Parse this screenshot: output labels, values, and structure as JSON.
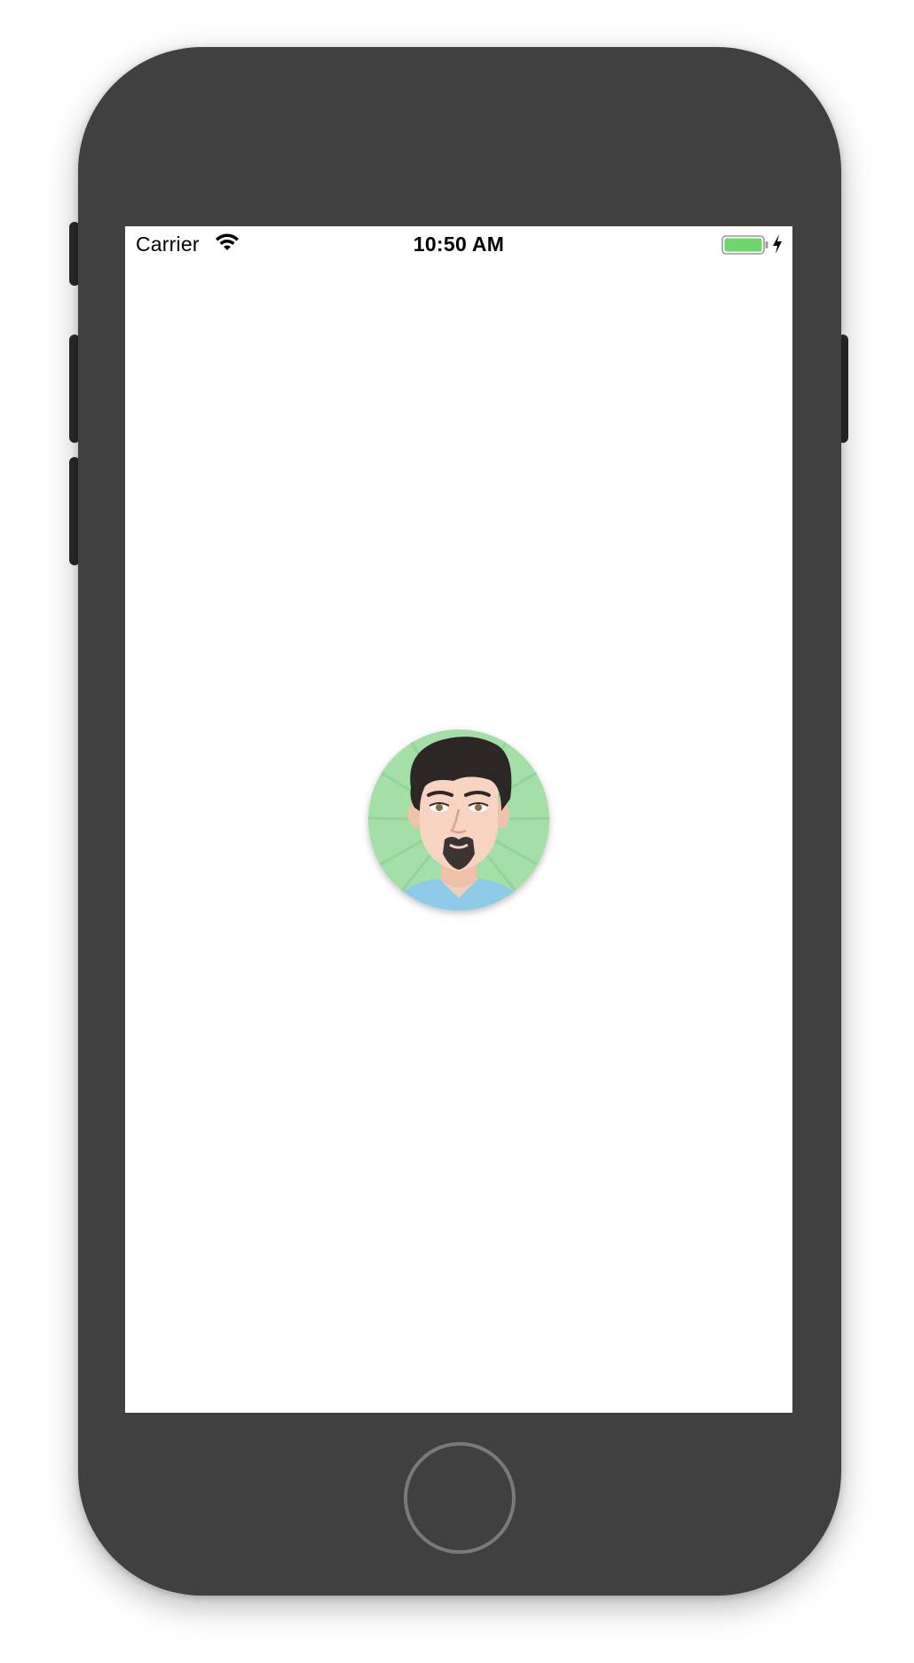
{
  "status_bar": {
    "carrier": "Carrier",
    "time": "10:50 AM",
    "battery_color": "#6fd56f"
  },
  "avatar": {
    "icon": "avatar-profile-picture",
    "background_color": "#a5dfa8"
  },
  "device": {
    "body_color": "#404040",
    "home_button_icon": "home-button-ring"
  }
}
